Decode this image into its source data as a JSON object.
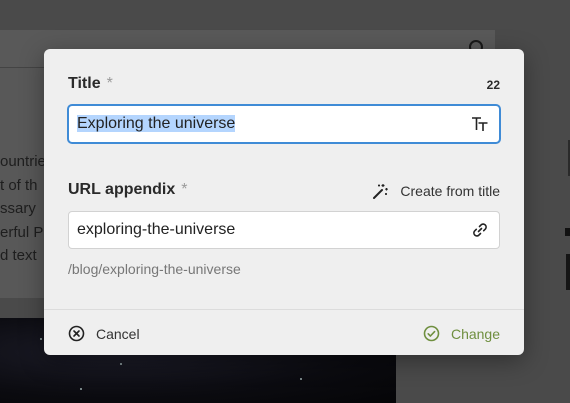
{
  "background": {
    "text_lines": [
      "ountrie",
      "t of th",
      "ssary",
      "erful P",
      "d text"
    ]
  },
  "dialog": {
    "title_field": {
      "label": "Title",
      "required_mark": "*",
      "counter": "22",
      "value": "Exploring the universe",
      "icon": "text-format-icon"
    },
    "url_field": {
      "label": "URL appendix",
      "required_mark": "*",
      "create_label": "Create from title",
      "value": "exploring-the-universe",
      "icon": "link-icon",
      "path_preview": "/blog/exploring-the-universe"
    },
    "buttons": {
      "cancel_label": "Cancel",
      "change_label": "Change"
    },
    "colors": {
      "focus_border": "#3f8bd6",
      "selection": "#b4d5fe",
      "change_accent": "#6f8f3f"
    }
  }
}
